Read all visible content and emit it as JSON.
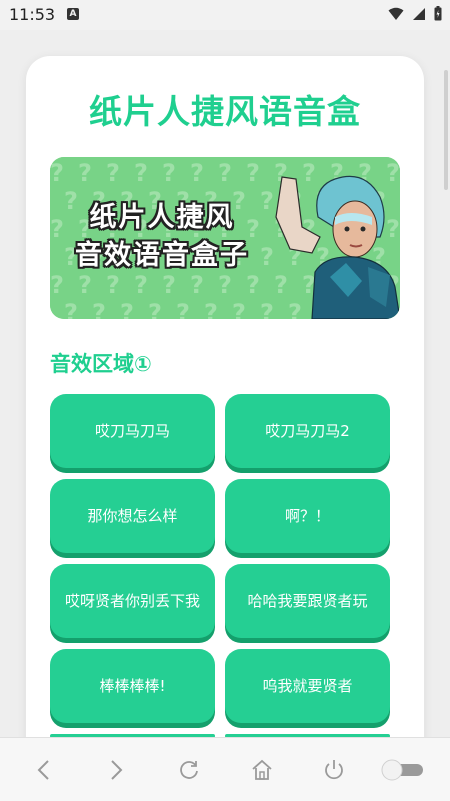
{
  "status_bar": {
    "time": "11:53",
    "notification_letter": "A",
    "icons": [
      "wifi-icon",
      "signal-icon",
      "battery-icon"
    ]
  },
  "app": {
    "title": "纸片人捷风语音盒"
  },
  "banner": {
    "line1": "纸片人捷风",
    "line2": "音效语音盒子",
    "pattern_glyph": "?"
  },
  "section": {
    "title": "音效区域①"
  },
  "sound_buttons": [
    {
      "label": "哎刀马刀马"
    },
    {
      "label": "哎刀马刀马2"
    },
    {
      "label": "那你想怎么样"
    },
    {
      "label": "啊？！"
    },
    {
      "label": "哎呀贤者你别丢下我"
    },
    {
      "label": "哈哈我要跟贤者玩"
    },
    {
      "label": "棒棒棒棒!"
    },
    {
      "label": "呜我就要贤者"
    }
  ],
  "colors": {
    "accent": "#1fcf8f",
    "button": "#25cf93",
    "button_shadow": "#14a06c",
    "banner_bg": "#7ed488"
  },
  "nav_bar": {
    "icons": [
      "back-icon",
      "forward-icon",
      "refresh-icon",
      "home-icon",
      "power-icon",
      "toggle-switch"
    ]
  }
}
